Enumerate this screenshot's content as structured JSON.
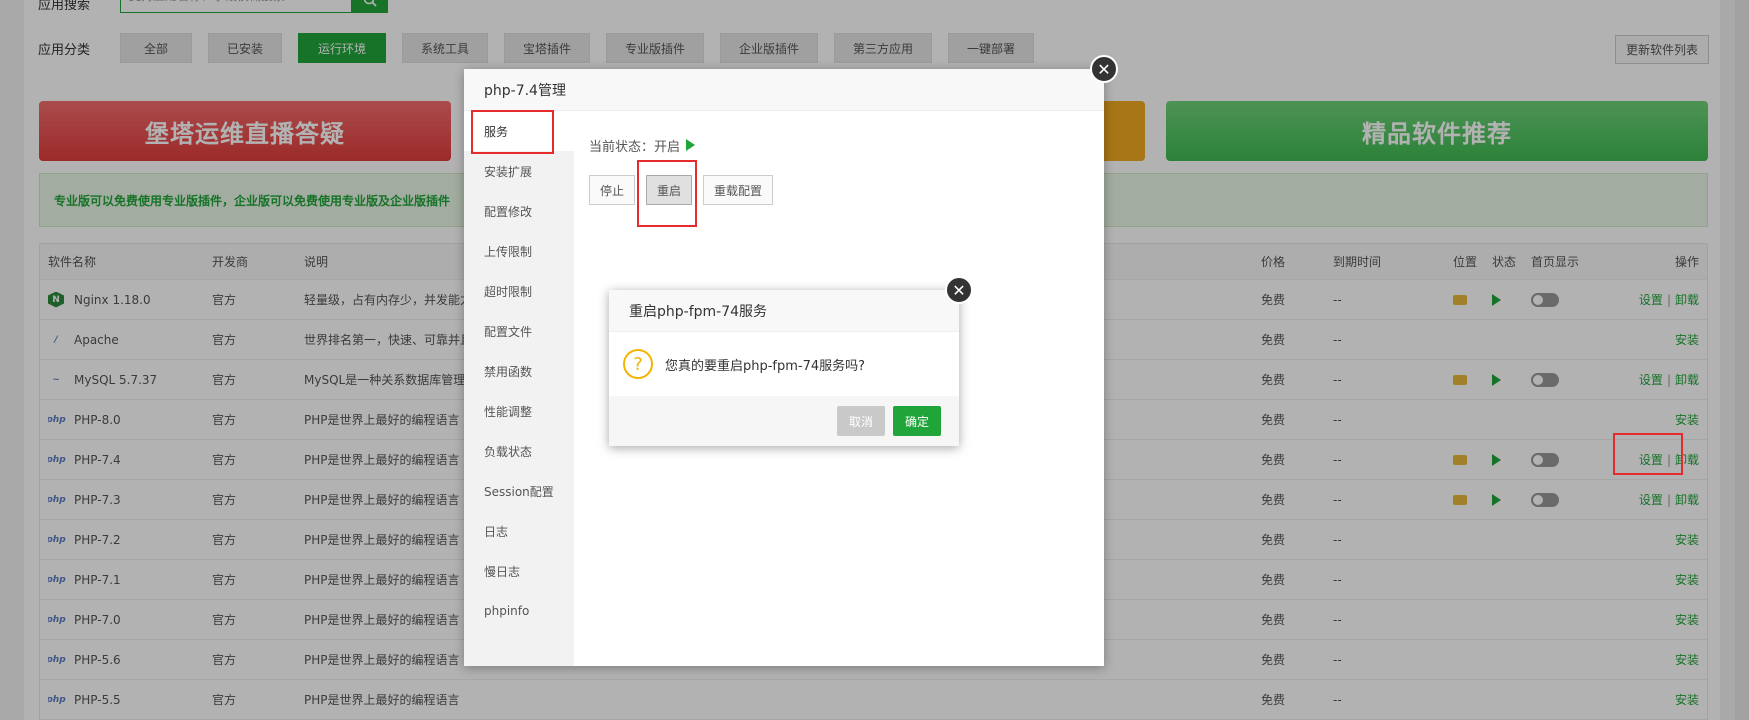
{
  "page": {
    "search_label": "应用搜索",
    "search_placeholder": "支持应用名称、字段模糊搜索",
    "category_label": "应用分类",
    "categories": [
      {
        "label": "全部",
        "w": 72
      },
      {
        "label": "已安装",
        "w": 74
      },
      {
        "label": "运行环境",
        "w": 88,
        "active": true
      },
      {
        "label": "系统工具",
        "w": 86
      },
      {
        "label": "宝塔插件",
        "w": 86
      },
      {
        "label": "专业版插件",
        "w": 98
      },
      {
        "label": "企业版插件",
        "w": 98
      },
      {
        "label": "第三方应用",
        "w": 98
      },
      {
        "label": "一键部署",
        "w": 86
      }
    ],
    "update_label": "更新软件列表",
    "banner_left": "堡塔运维直播答疑",
    "banner_right": "精品软件推荐",
    "notice": "专业版可以免费使用专业版插件，企业版可以免费使用专业版及企业版插件",
    "columns": {
      "name": "软件名称",
      "dev": "开发商",
      "desc": "说明",
      "price": "价格",
      "expire": "到期时间",
      "loc": "位置",
      "state": "状态",
      "home": "首页显示",
      "ops": "操作"
    },
    "rows": [
      {
        "logo": "N",
        "logo_type": "nginx",
        "name": "Nginx 1.18.0",
        "dev": "官方",
        "desc": "轻量级，占有内存少，并发能力强",
        "price": "免费",
        "expire": "--",
        "installed": true
      },
      {
        "logo": "/",
        "logo_type": "apache",
        "name": "Apache",
        "dev": "官方",
        "desc": "世界排名第一，快速、可靠并且可通过简单的API扩充",
        "price": "免费",
        "expire": "--",
        "installed": false
      },
      {
        "logo": "~",
        "logo_type": "mysql",
        "name": "MySQL 5.7.37",
        "dev": "官方",
        "desc": "MySQL是一种关系数据库管理系统",
        "price": "免费",
        "expire": "--",
        "installed": true
      },
      {
        "logo": "php",
        "logo_type": "php",
        "name": "PHP-8.0",
        "dev": "官方",
        "desc": "PHP是世界上最好的编程语言",
        "price": "免费",
        "expire": "--",
        "installed": false
      },
      {
        "logo": "php",
        "logo_type": "php",
        "name": "PHP-7.4",
        "dev": "官方",
        "desc": "PHP是世界上最好的编程语言",
        "price": "免费",
        "expire": "--",
        "installed": true
      },
      {
        "logo": "php",
        "logo_type": "php",
        "name": "PHP-7.3",
        "dev": "官方",
        "desc": "PHP是世界上最好的编程语言",
        "price": "免费",
        "expire": "--",
        "installed": true
      },
      {
        "logo": "php",
        "logo_type": "php",
        "name": "PHP-7.2",
        "dev": "官方",
        "desc": "PHP是世界上最好的编程语言",
        "price": "免费",
        "expire": "--",
        "installed": false
      },
      {
        "logo": "php",
        "logo_type": "php",
        "name": "PHP-7.1",
        "dev": "官方",
        "desc": "PHP是世界上最好的编程语言",
        "price": "免费",
        "expire": "--",
        "installed": false
      },
      {
        "logo": "php",
        "logo_type": "php",
        "name": "PHP-7.0",
        "dev": "官方",
        "desc": "PHP是世界上最好的编程语言",
        "price": "免费",
        "expire": "--",
        "installed": false
      },
      {
        "logo": "php",
        "logo_type": "php",
        "name": "PHP-5.6",
        "dev": "官方",
        "desc": "PHP是世界上最好的编程语言",
        "price": "免费",
        "expire": "--",
        "installed": false
      },
      {
        "logo": "php",
        "logo_type": "php",
        "name": "PHP-5.5",
        "dev": "官方",
        "desc": "PHP是世界上最好的编程语言",
        "price": "免费",
        "expire": "--",
        "installed": false
      }
    ],
    "op_settings": "设置",
    "op_uninstall": "卸载",
    "op_install": "安装",
    "op_sep": "|"
  },
  "php_dialog": {
    "title": "php-7.4管理",
    "menu": [
      "服务",
      "安装扩展",
      "配置修改",
      "上传限制",
      "超时限制",
      "配置文件",
      "禁用函数",
      "性能调整",
      "负载状态",
      "Session配置",
      "日志",
      "慢日志",
      "phpinfo"
    ],
    "status_label": "当前状态：开启",
    "buttons": {
      "stop": "停止",
      "restart": "重启",
      "reload": "重载配置"
    }
  },
  "confirm": {
    "title": "重启php-fpm-74服务",
    "message": "您真的要重启php-fpm-74服务吗?",
    "cancel": "取消",
    "ok": "确定",
    "icon": "?"
  },
  "icons": {
    "close": "✕",
    "search": "search-icon"
  },
  "colors": {
    "accent": "#20a53a",
    "annotation": "#e52b2b"
  }
}
